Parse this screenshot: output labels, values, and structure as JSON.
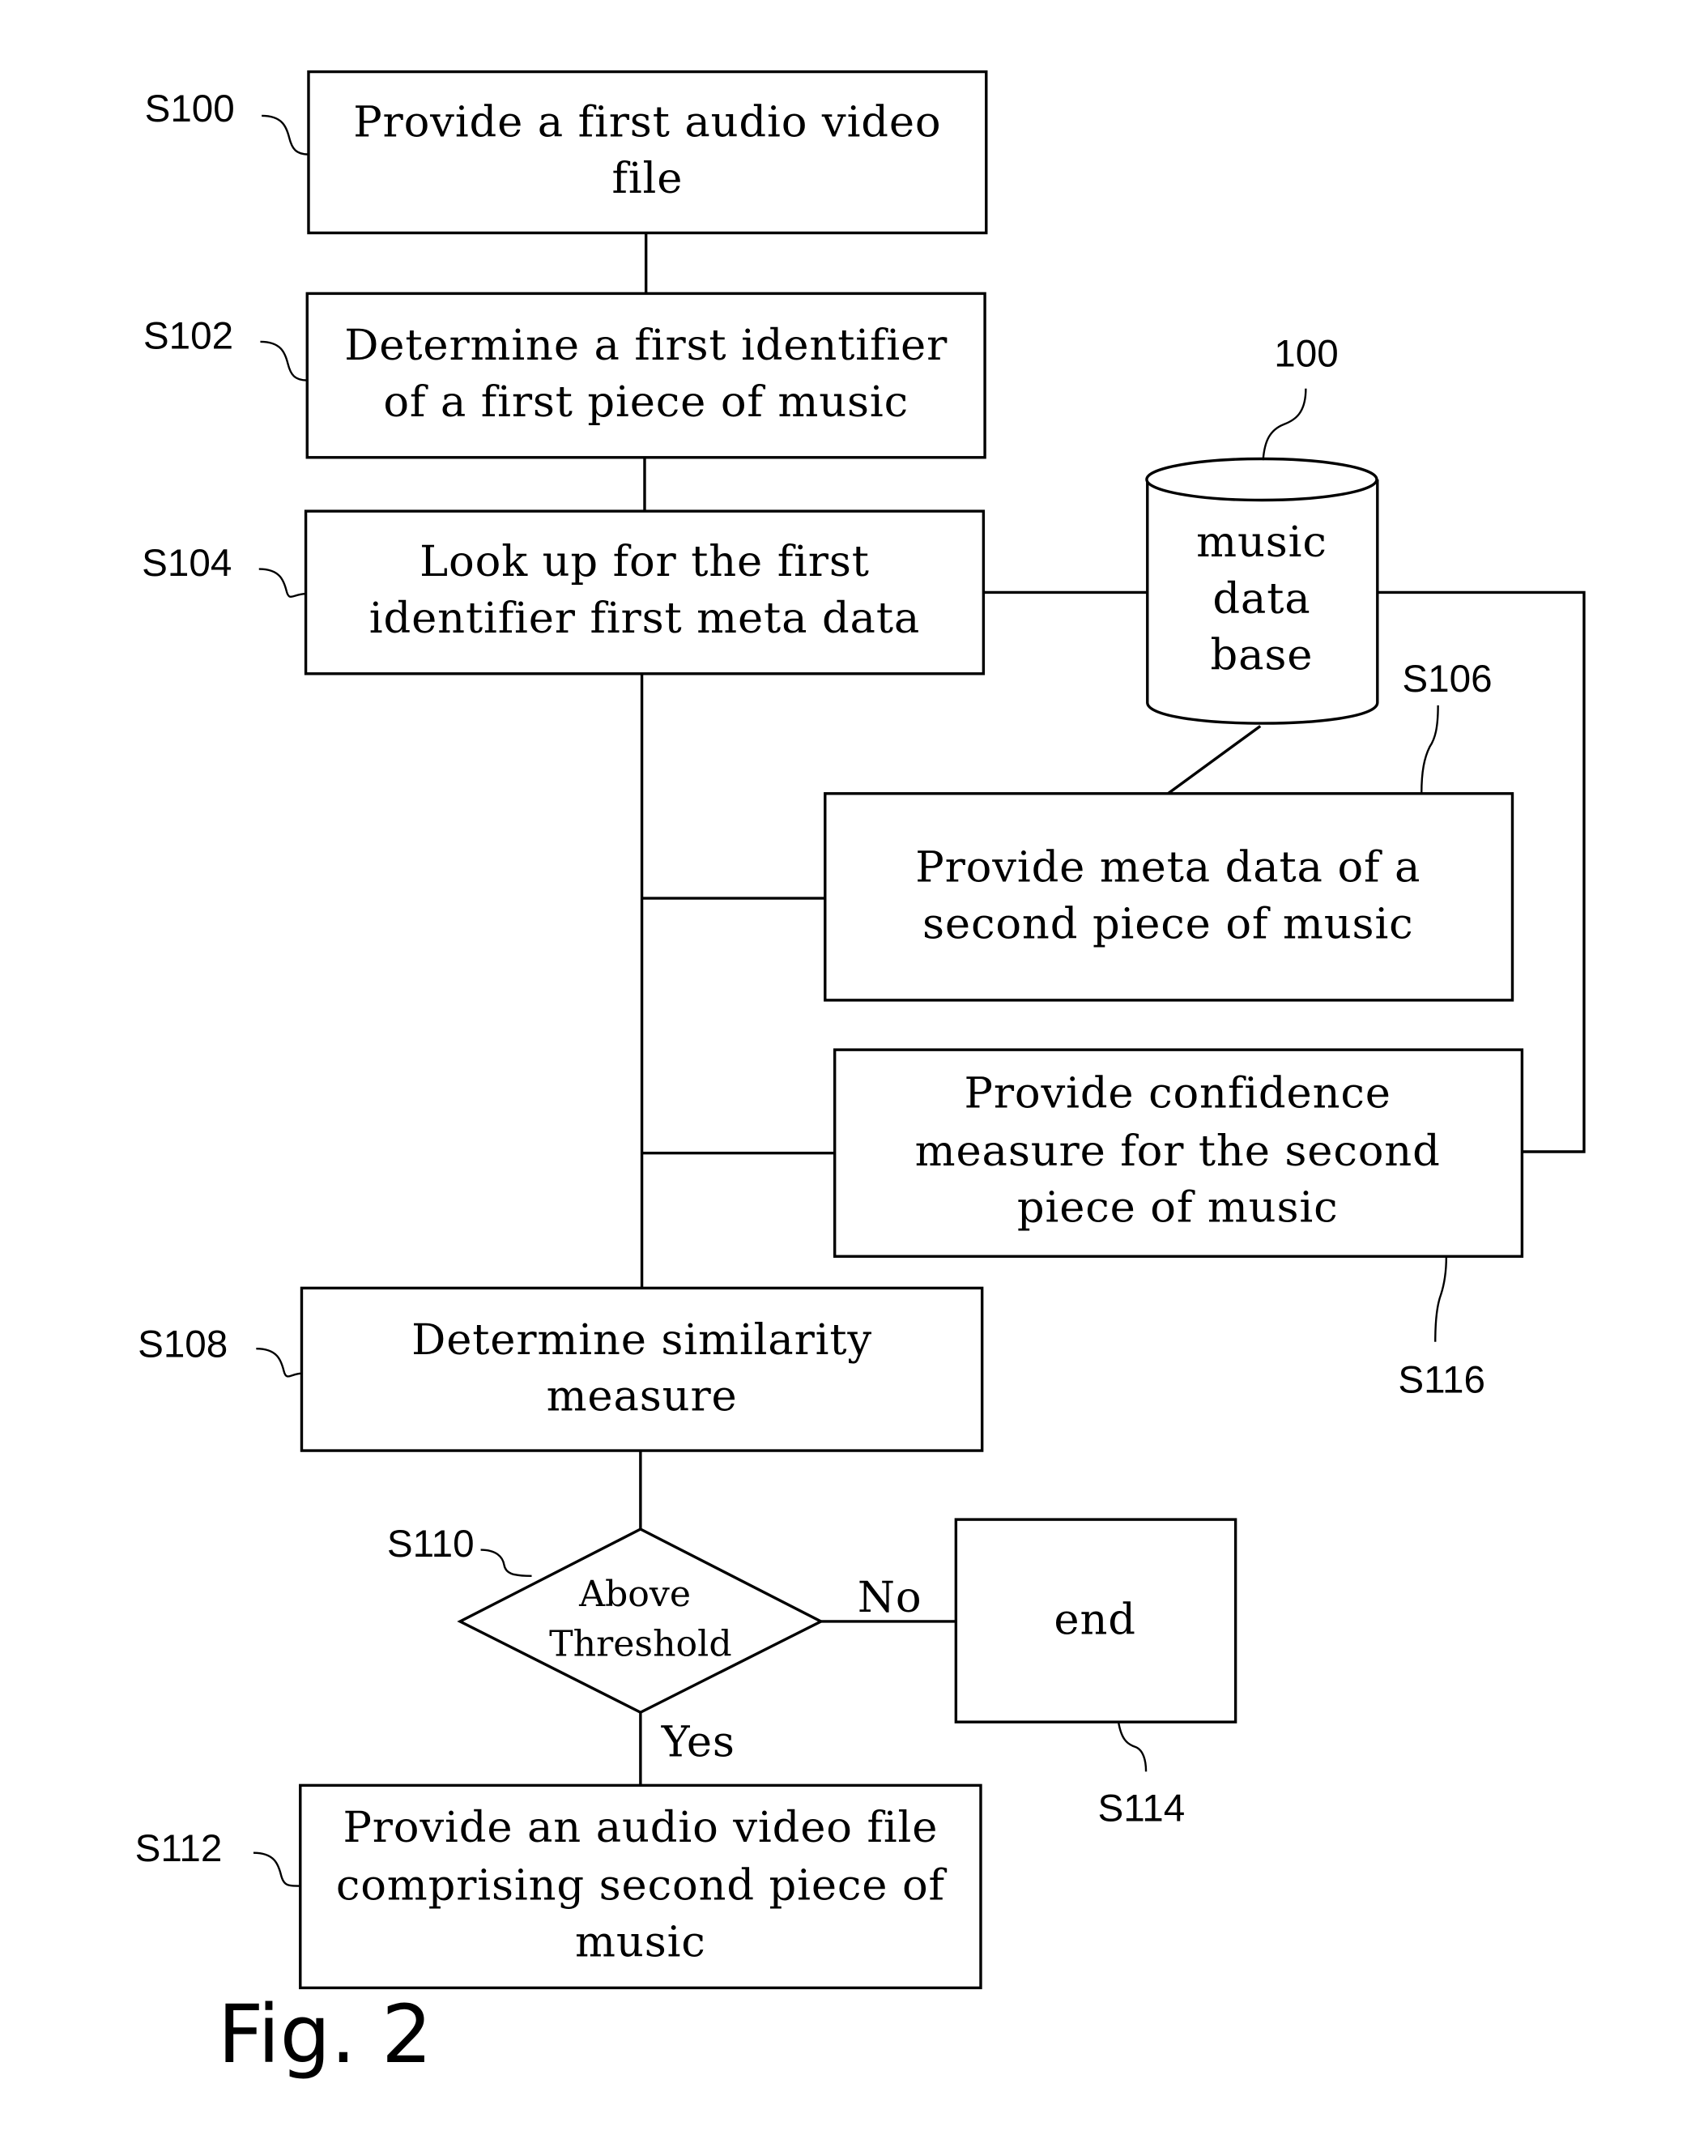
{
  "figure_label": "Fig. 2",
  "steps": {
    "s100": {
      "ref": "S100",
      "lines": [
        "Provide a first audio video",
        "file"
      ]
    },
    "s102": {
      "ref": "S102",
      "lines": [
        "Determine a first identifier",
        "of a first piece of music"
      ]
    },
    "s104": {
      "ref": "S104",
      "lines": [
        "Look up for the first",
        "identifier first meta data"
      ]
    },
    "s106": {
      "ref": "S106",
      "lines": [
        "Provide meta data of a",
        "second piece of music"
      ]
    },
    "s116": {
      "ref": "S116",
      "lines": [
        "Provide confidence",
        "measure for the second",
        "piece of music"
      ]
    },
    "s108": {
      "ref": "S108",
      "lines": [
        "Determine similarity",
        "measure"
      ]
    },
    "s110": {
      "ref": "S110",
      "lines": [
        "Above",
        "Threshold"
      ]
    },
    "s114": {
      "ref": "S114",
      "lines": [
        "end"
      ]
    },
    "s112": {
      "ref": "S112",
      "lines": [
        "Provide an audio video file",
        "comprising second piece of",
        "music"
      ]
    }
  },
  "database": {
    "ref": "100",
    "lines": [
      "music",
      "data",
      "base"
    ]
  },
  "branches": {
    "no": "No",
    "yes": "Yes"
  }
}
